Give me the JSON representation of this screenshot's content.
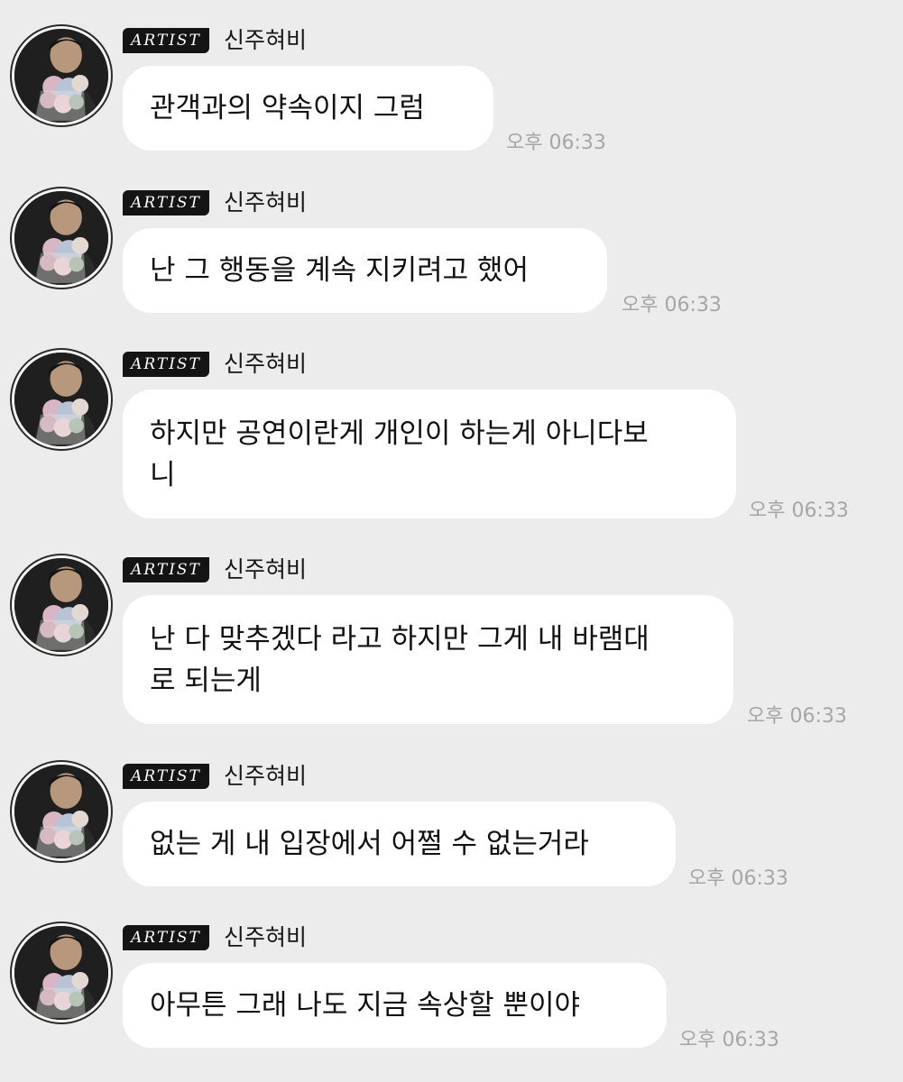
{
  "sender_badge": "ARTIST",
  "sender_name": "신주혀비",
  "messages": [
    {
      "text": "관객과의 약속이지 그럼",
      "time": "오후 06:33"
    },
    {
      "text": "난 그 행동을 계속 지키려고 했어",
      "time": "오후 06:33"
    },
    {
      "text": "하지만 공연이란게 개인이 하는게 아니다보\n니",
      "time": "오후 06:33"
    },
    {
      "text": "난 다 맞추겠다 라고 하지만 그게 내 바램대\n로 되는게",
      "time": "오후 06:33"
    },
    {
      "text": "없는 게 내 입장에서 어쩔 수 없는거라",
      "time": "오후 06:33"
    },
    {
      "text": "아무튼 그래 나도 지금 속상할 뿐이야",
      "time": "오후 06:33"
    }
  ]
}
